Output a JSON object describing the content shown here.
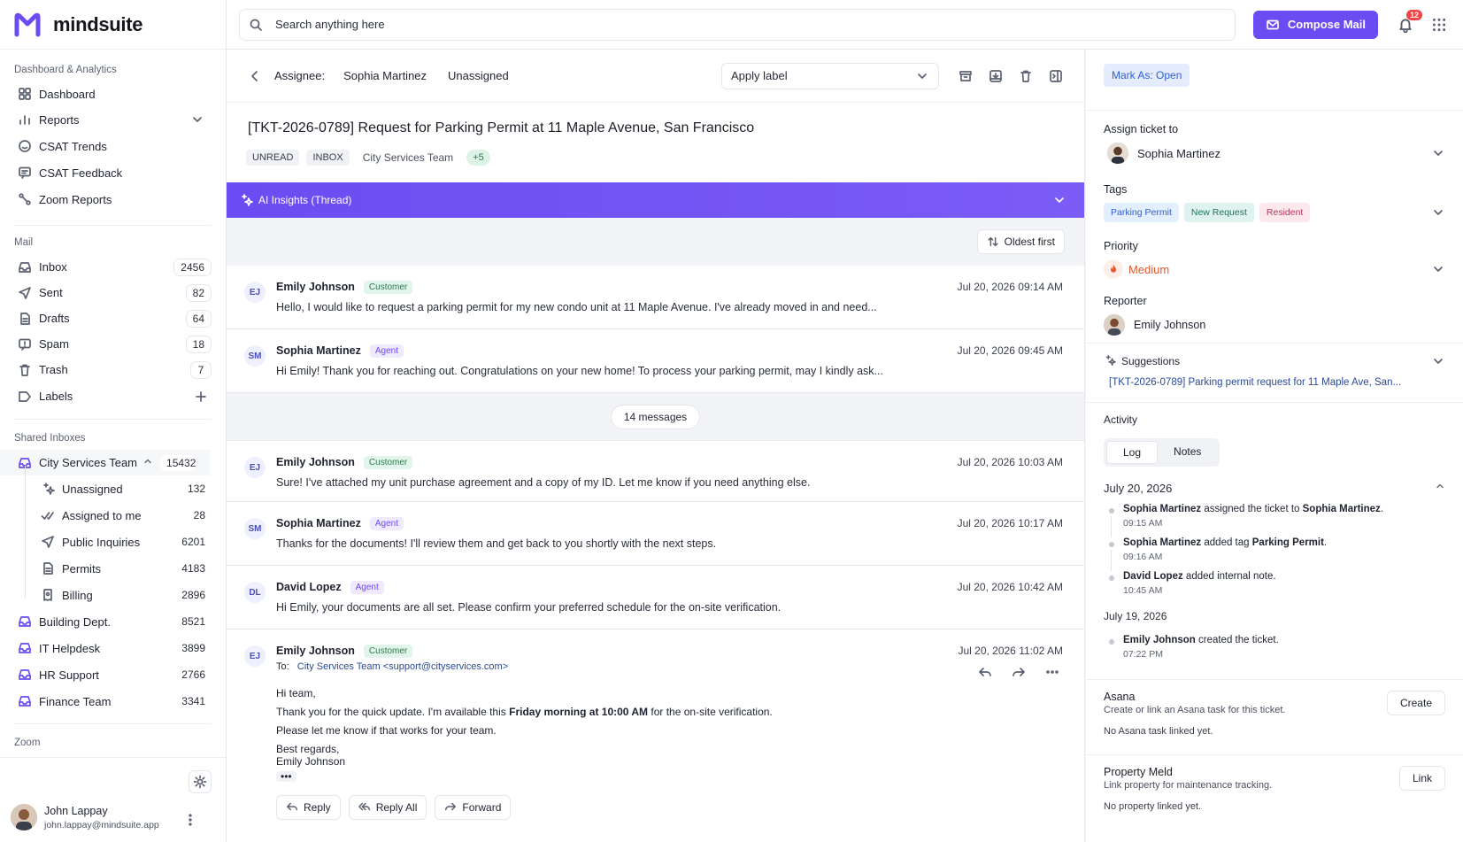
{
  "app": {
    "name": "mindsuite"
  },
  "search": {
    "placeholder": "Search anything here"
  },
  "topbar": {
    "compose_label": "Compose Mail",
    "notification_count": "12"
  },
  "sidebar": {
    "sections": {
      "analytics": "Dashboard & Analytics",
      "mail": "Mail",
      "shared": "Shared Inboxes",
      "zoom": "Zoom"
    },
    "analytics_items": [
      {
        "label": "Dashboard",
        "icon": "grid-icon"
      },
      {
        "label": "Reports",
        "icon": "bar-chart-icon"
      },
      {
        "label": "CSAT Trends",
        "icon": "smile-icon"
      },
      {
        "label": "CSAT Feedback",
        "icon": "message-icon"
      },
      {
        "label": "Zoom Reports",
        "icon": "route-icon"
      }
    ],
    "mail_items": [
      {
        "label": "Inbox",
        "count": "2456"
      },
      {
        "label": "Sent",
        "count": "82"
      },
      {
        "label": "Drafts",
        "count": "64"
      },
      {
        "label": "Spam",
        "count": "18"
      },
      {
        "label": "Trash",
        "count": "7"
      },
      {
        "label": "Labels"
      }
    ],
    "shared_root": {
      "label": "City Services Team",
      "count": "15432"
    },
    "shared_sub": [
      {
        "label": "Unassigned",
        "count": "132"
      },
      {
        "label": "Assigned to me",
        "count": "28"
      },
      {
        "label": "Public Inquiries",
        "count": "6201"
      },
      {
        "label": "Permits",
        "count": "4183"
      },
      {
        "label": "Billing",
        "count": "2896"
      }
    ],
    "shared_other": [
      {
        "label": "Building Dept.",
        "count": "8521"
      },
      {
        "label": "IT Helpdesk",
        "count": "3899"
      },
      {
        "label": "HR Support",
        "count": "2766"
      },
      {
        "label": "Finance Team",
        "count": "3341"
      }
    ],
    "user": {
      "name": "John Lappay",
      "email": "john.lappay@mindsuite.app"
    }
  },
  "ticket": {
    "assignee_label": "Assignee:",
    "assignee_name": "Sophia Martinez",
    "assignee_alt": "Unassigned",
    "apply_label": "Apply label",
    "subject": "[TKT-2026-0789] Request for Parking Permit at 11 Maple Avenue, San Francisco",
    "chips": [
      "UNREAD",
      "INBOX",
      "City Services Team",
      "+5"
    ],
    "ai_bar": "AI Insights (Thread)",
    "sort_label": "Oldest first",
    "collapsed_label": "14 messages"
  },
  "messages": [
    {
      "initials": "EJ",
      "name": "Emily Johnson",
      "role": "Customer",
      "time": "Jul 20, 2026 09:14 AM",
      "body": "Hello, I would like to request a parking permit for my new condo unit at 11 Maple Avenue. I've already moved in and need..."
    },
    {
      "initials": "SM",
      "name": "Sophia Martinez",
      "role": "Agent",
      "time": "Jul 20, 2026 09:45 AM",
      "body": "Hi Emily! Thank you for reaching out. Congratulations on your new home! To process your parking permit, may I kindly ask..."
    },
    {
      "initials": "EJ",
      "name": "Emily Johnson",
      "role": "Customer",
      "time": "Jul 20, 2026 10:03 AM",
      "body": "Sure! I've attached my unit purchase agreement and a copy of my ID. Let me know if you need anything else."
    },
    {
      "initials": "SM",
      "name": "Sophia Martinez",
      "role": "Agent",
      "time": "Jul 20, 2026 10:17 AM",
      "body": "Thanks for the documents! I'll review them and get back to you shortly with the next steps."
    },
    {
      "initials": "DL",
      "name": "David Lopez",
      "role": "Agent",
      "time": "Jul 20, 2026 10:42 AM",
      "body": "Hi Emily, your documents are all set. Please confirm your preferred schedule for the on-site verification."
    }
  ],
  "open_message": {
    "initials": "EJ",
    "name": "Emily Johnson",
    "role": "Customer",
    "time": "Jul 20, 2026 11:02 AM",
    "to_label": "To:",
    "to_value": "City Services Team <support@cityservices.com>",
    "greeting": "Hi team,",
    "line1_pre": "Thank you for the quick update. I'm available this ",
    "line1_bold": "Friday morning at 10:00 AM",
    "line1_post": " for the on-site verification.",
    "line2": "Please let me know if that works for your team.",
    "signoff": "Best regards,",
    "signature": "Emily Johnson",
    "reply": "Reply",
    "reply_all": "Reply All",
    "forward": "Forward"
  },
  "details": {
    "mark_open": "Mark As: Open",
    "assign_label": "Assign ticket to",
    "assign_value": "Sophia Martinez",
    "tags_label": "Tags",
    "tags": [
      "Parking Permit",
      "New Request",
      "Resident"
    ],
    "priority_label": "Priority",
    "priority_value": "Medium",
    "reporter_label": "Reporter",
    "reporter_value": "Emily Johnson",
    "suggestions_label": "Suggestions",
    "suggestion": "[TKT-2026-0789] Parking permit request for 11 Maple Ave, San...",
    "activity_label": "Activity",
    "tabs": [
      "Log",
      "Notes"
    ],
    "day1": "July 20, 2026",
    "day1_items": [
      {
        "actor": "Sophia Martinez",
        "action": " assigned the ticket to ",
        "target": "Sophia Martinez",
        "end": ".",
        "time": "09:15 AM"
      },
      {
        "actor": "Sophia Martinez",
        "action": " added tag ",
        "target": "Parking Permit",
        "end": ".",
        "time": "09:16 AM"
      },
      {
        "actor": "David Lopez",
        "action": " added internal note.",
        "target": "",
        "end": "",
        "time": "10:45 AM"
      }
    ],
    "day2": "July 19, 2026",
    "day2_items": [
      {
        "actor": "Emily Johnson",
        "action": " created the ticket.",
        "time": "07:22 PM"
      }
    ],
    "asana": {
      "title": "Asana",
      "sub": "Create or link an Asana task for this ticket.",
      "btn": "Create",
      "note": "No Asana task linked yet."
    },
    "meld": {
      "title": "Property Meld",
      "sub": "Link property for maintenance tracking.",
      "btn": "Link",
      "note": "No property linked yet."
    }
  },
  "colors": {
    "accent": "#6a4cf2",
    "badge": "#ef4444",
    "priority": "#e8572e"
  }
}
